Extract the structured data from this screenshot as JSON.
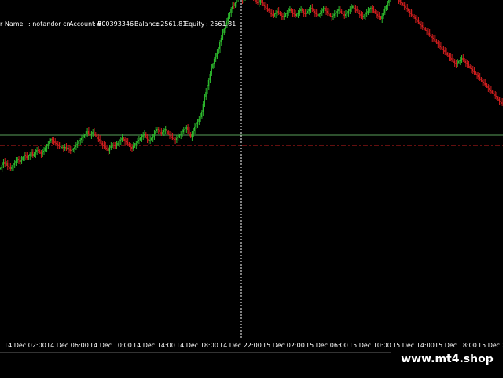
{
  "account_info": {
    "name_label": "r Name",
    "name_value": ": notandor cn",
    "account_label": "Account #",
    "account_value": ": 500393346",
    "balance_label": "Balance",
    "balance_value": ": 2561.81",
    "equity_label": "Equity",
    "equity_value": ": 2561.81"
  },
  "time_axis": {
    "labels": [
      "14 Dec 02:00",
      "14 Dec 06:00",
      "14 Dec 10:00",
      "14 Dec 14:00",
      "14 Dec 18:00",
      "14 Dec 22:00",
      "15 Dec 02:00",
      "15 Dec 06:00",
      "15 Dec 10:00",
      "15 Dec 14:00",
      "15 Dec 18:00",
      "15 Dec 2"
    ]
  },
  "watermark": "www.mt4.shop",
  "colors": {
    "background": "#000000",
    "bull_candle": "#2db82d",
    "bear_candle": "#d21e1e",
    "horizontal_level": "#5aa05a",
    "dashdot_level": "#c81e1e",
    "crosshair": "#ffffff",
    "text": "#ffffff"
  },
  "chart_data": {
    "type": "candlestick",
    "title": "",
    "close_series": [
      218,
      222,
      226,
      223,
      225,
      221,
      219,
      217,
      220,
      222,
      224,
      227,
      230,
      228,
      226,
      229,
      232,
      235,
      233,
      231,
      233,
      236,
      238,
      234,
      236,
      239,
      241,
      240,
      238,
      236,
      238,
      240,
      244,
      246,
      249,
      252,
      255,
      254,
      252,
      250,
      249,
      247,
      246,
      245,
      245,
      244,
      245,
      243,
      244,
      242,
      240,
      241,
      242,
      245,
      247,
      249,
      252,
      254,
      256,
      258,
      260,
      262,
      265,
      262,
      260,
      262,
      264,
      262,
      260,
      258,
      255,
      252,
      250,
      248,
      246,
      244,
      242,
      240,
      244,
      246,
      248,
      247,
      246,
      248,
      250,
      252,
      254,
      256,
      255,
      253,
      251,
      249,
      247,
      245,
      243,
      246,
      248,
      250,
      252,
      254,
      256,
      258,
      260,
      262,
      258,
      255,
      252,
      254,
      256,
      258,
      262,
      265,
      268,
      266,
      264,
      262,
      264,
      266,
      268,
      265,
      262,
      260,
      258,
      257,
      255,
      254,
      256,
      258,
      260,
      262,
      264,
      266,
      268,
      270,
      266,
      262,
      258,
      262,
      265,
      270,
      274,
      277,
      280,
      283,
      290,
      300,
      308,
      315,
      322,
      330,
      338,
      346,
      350,
      357,
      360,
      365,
      370,
      378,
      384,
      390,
      395,
      400,
      405,
      410,
      415,
      420,
      425,
      424,
      428,
      433,
      438,
      436,
      434,
      432,
      434,
      436,
      438,
      440,
      438,
      436,
      438,
      436,
      434,
      430,
      428,
      430,
      432,
      428,
      426,
      424,
      422,
      420,
      418,
      416,
      414,
      412,
      414,
      416,
      418,
      416,
      414,
      412,
      410,
      412,
      414,
      416,
      418,
      420,
      418,
      416,
      414,
      412,
      414,
      416,
      418,
      420,
      418,
      416,
      414,
      416,
      418,
      420,
      422,
      420,
      418,
      416,
      414,
      412,
      414,
      416,
      418,
      420,
      422,
      418,
      416,
      414,
      412,
      410,
      412,
      414,
      416,
      418,
      420,
      418,
      416,
      414,
      412,
      414,
      416,
      418,
      420,
      422,
      424,
      422,
      420,
      418,
      416,
      414,
      412,
      410,
      412,
      414,
      416,
      418,
      420,
      422,
      420,
      418,
      416,
      414,
      412,
      410,
      408,
      412,
      416,
      420,
      424,
      428,
      432,
      436,
      438,
      440,
      438,
      436,
      434,
      432,
      430,
      428,
      426,
      424,
      422,
      420,
      418,
      416,
      414,
      412,
      410,
      408,
      406,
      404,
      402,
      400,
      398,
      396,
      394,
      392,
      390,
      388,
      386,
      384,
      382,
      380,
      378,
      376,
      374,
      372,
      370,
      368,
      366,
      364,
      362,
      360,
      358,
      356,
      354,
      352,
      350,
      352,
      354,
      356,
      358,
      356,
      354,
      352,
      350,
      348,
      346,
      344,
      342,
      340,
      338,
      336,
      334,
      332,
      330,
      328,
      326,
      324,
      322,
      320,
      318,
      316,
      314,
      312,
      310,
      308,
      306,
      304,
      302,
      300
    ]
  }
}
